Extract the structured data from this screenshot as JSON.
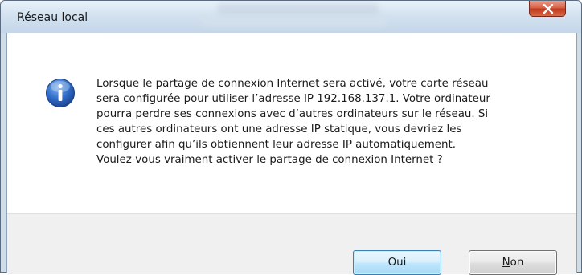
{
  "window": {
    "title": "Réseau local"
  },
  "message": {
    "lines": [
      "Lorsque le partage de connexion Internet sera activé, votre carte réseau",
      "sera configurée pour utiliser l’adresse IP 192.168.137.1. Votre ordinateur",
      "pourra perdre ses connexions avec d’autres ordinateurs sur le réseau. Si",
      "ces autres ordinateurs ont une adresse IP statique, vous devriez les",
      "configurer afin qu’ils obtiennent leur adresse IP automatiquement.",
      "Voulez-vous vraiment activer le partage de connexion Internet ?"
    ],
    "icon": "info-icon"
  },
  "buttons": {
    "yes_label": "Oui",
    "no_accel": "N",
    "no_rest": "on"
  },
  "colors": {
    "titlebar": "#d3e2f0",
    "close_button": "#c0391c",
    "default_button_border": "#3c7fb1",
    "footer": "#f0f0f0"
  }
}
